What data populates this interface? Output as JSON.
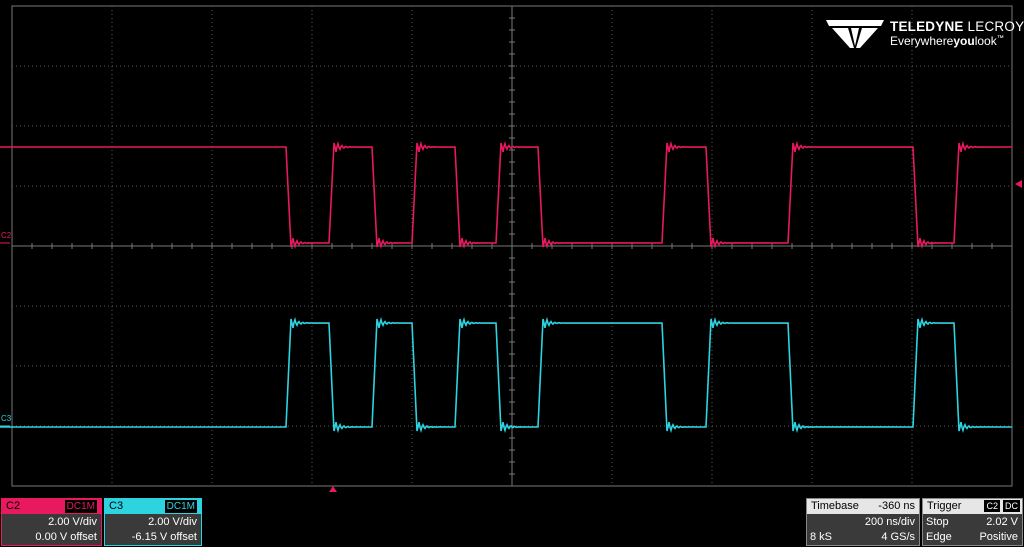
{
  "brand": {
    "name_bold": "TELEDYNE",
    "name_light": " LECROY",
    "tag_pre": "Everywhere",
    "tag_bold": "you",
    "tag_post": "look",
    "tm": "™"
  },
  "colors": {
    "c2": "#e8195f",
    "c3": "#2ed3e0",
    "grid": "#5a5a5a"
  },
  "channels": {
    "c2": {
      "name": "C2",
      "coupling": "DC1M",
      "scale": "2.00 V/div",
      "offset": "0.00 V offset",
      "marker": "C2"
    },
    "c3": {
      "name": "C3",
      "coupling": "DC1M",
      "scale": "2.00 V/div",
      "offset": "-6.15 V offset",
      "marker": "C3"
    }
  },
  "timebase": {
    "title": "Timebase",
    "delay": "-360 ns",
    "per_div": "200 ns/div",
    "samples": "8 kS",
    "rate": "4 GS/s"
  },
  "trigger": {
    "title": "Trigger",
    "source": "C2",
    "coupling": "DC",
    "mode": "Stop",
    "level": "2.02 V",
    "type": "Edge",
    "slope": "Positive"
  },
  "waveforms": {
    "c2_edges": [
      289,
      332,
      375,
      415,
      458,
      499,
      541,
      665,
      709,
      791,
      916,
      957
    ],
    "c2_start_high": true,
    "c3_edges": [
      289,
      332,
      375,
      415,
      458,
      499,
      541,
      665,
      709,
      791,
      916,
      957
    ],
    "c3_start_high": false
  }
}
